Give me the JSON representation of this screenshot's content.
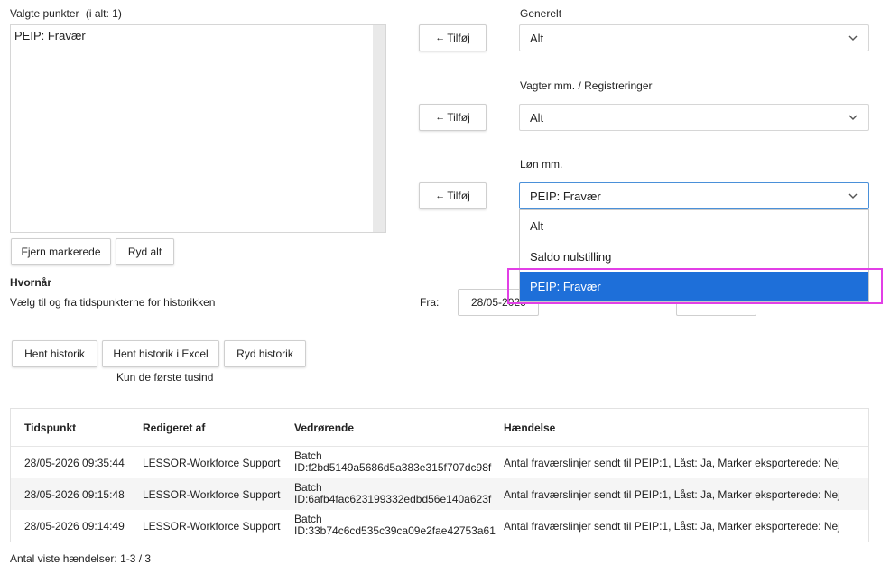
{
  "selected_points": {
    "label": "Valgte punkter",
    "count": "(i alt: 1)",
    "items": [
      "PEIP: Fravær"
    ],
    "remove_button": "Fjern markerede",
    "clear_button": "Ryd alt"
  },
  "groups": [
    {
      "label": "Generelt",
      "add_button": "Tilføj",
      "value": "Alt"
    },
    {
      "label": "Vagter mm. / Registreringer",
      "add_button": "Tilføj",
      "value": "Alt"
    },
    {
      "label": "Løn mm.",
      "add_button": "Tilføj",
      "value": "PEIP: Fravær"
    }
  ],
  "dropdown": {
    "options": [
      "Alt",
      "Saldo nulstilling",
      "PEIP: Fravær"
    ],
    "selected_index": 2
  },
  "when": {
    "title": "Hvornår",
    "description": "Vælg til og fra tidspunkterne for historikken",
    "from_label": "Fra:",
    "from_value": "28/05-2026"
  },
  "actions": {
    "fetch": "Hent historik",
    "fetch_excel": "Hent historik i Excel",
    "clear_history": "Ryd historik",
    "note": "Kun de første tusind"
  },
  "table": {
    "headers": [
      "Tidspunkt",
      "Redigeret af",
      "Vedrørende",
      "Hændelse"
    ],
    "rows": [
      {
        "time": "28/05-2026 09:35:44",
        "editor": "LESSOR-Workforce Support",
        "concern_line1": "Batch",
        "concern_line2": "ID:f2bd5149a5686d5a383e315f707dc98f",
        "event": "Antal fraværslinjer sendt til PEIP:1, Låst: Ja, Marker eksporterede: Nej"
      },
      {
        "time": "28/05-2026 09:15:48",
        "editor": "LESSOR-Workforce Support",
        "concern_line1": "Batch",
        "concern_line2": "ID:6afb4fac623199332edbd56e140a623f",
        "event": "Antal fraværslinjer sendt til PEIP:1, Låst: Ja, Marker eksporterede: Nej"
      },
      {
        "time": "28/05-2026 09:14:49",
        "editor": "LESSOR-Workforce Support",
        "concern_line1": "Batch",
        "concern_line2": "ID:33b74c6cd535c39ca09e2fae42753a61",
        "event": "Antal fraværslinjer sendt til PEIP:1, Låst: Ja, Marker eksporterede: Nej"
      }
    ]
  },
  "footer": {
    "shown_events": "Antal viste hændelser: 1-3 / 3"
  },
  "colors": {
    "accent": "#1e6fd9",
    "highlight": "#e23fe6"
  }
}
